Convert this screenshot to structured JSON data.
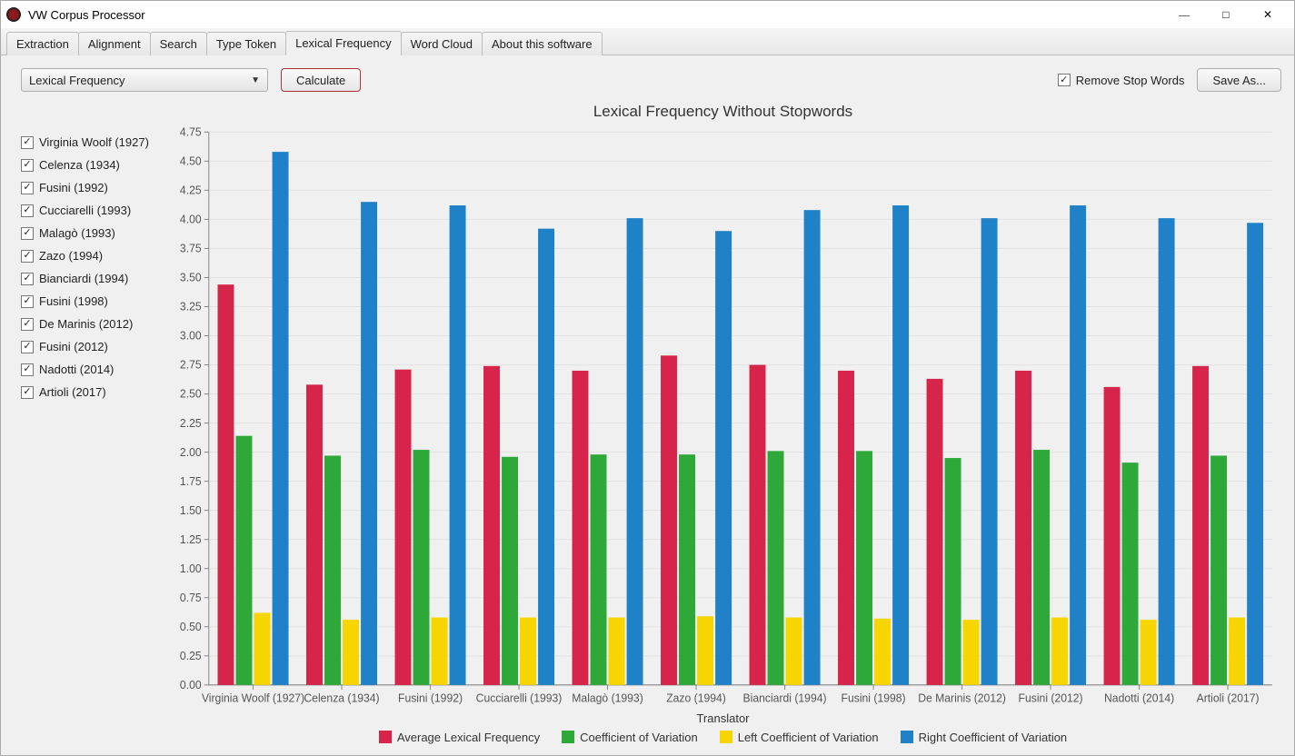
{
  "window": {
    "title": "VW Corpus Processor"
  },
  "tabs": {
    "items": [
      "Extraction",
      "Alignment",
      "Search",
      "Type Token",
      "Lexical Frequency",
      "Word Cloud",
      "About this software"
    ],
    "active_index": 4
  },
  "toolbar": {
    "combo_value": "Lexical Frequency",
    "calculate_label": "Calculate",
    "remove_stopwords_label": "Remove Stop Words",
    "remove_stopwords_checked": true,
    "save_as_label": "Save As..."
  },
  "sidebar": {
    "items": [
      {
        "label": "Virginia Woolf (1927)",
        "checked": true
      },
      {
        "label": "Celenza (1934)",
        "checked": true
      },
      {
        "label": "Fusini (1992)",
        "checked": true
      },
      {
        "label": "Cucciarelli (1993)",
        "checked": true
      },
      {
        "label": "Malagò (1993)",
        "checked": true
      },
      {
        "label": "Zazo (1994)",
        "checked": true
      },
      {
        "label": "Bianciardi (1994)",
        "checked": true
      },
      {
        "label": "Fusini (1998)",
        "checked": true
      },
      {
        "label": "De Marinis (2012)",
        "checked": true
      },
      {
        "label": "Fusini (2012)",
        "checked": true
      },
      {
        "label": "Nadotti (2014)",
        "checked": true
      },
      {
        "label": "Artioli (2017)",
        "checked": true
      }
    ]
  },
  "chart": {
    "title": "Lexical Frequency Without Stopwords",
    "xlabel": "Translator",
    "legend": [
      "Average Lexical Frequency",
      "Coefficient of Variation",
      "Left Coefficient of Variation",
      "Right Coefficient of Variation"
    ],
    "colors": {
      "avg": "#d7244a",
      "cv": "#2fa83a",
      "lcv": "#f7d500",
      "rcv": "#1f82c8"
    },
    "y_ticks": [
      0.0,
      0.25,
      0.5,
      0.75,
      1.0,
      1.25,
      1.5,
      1.75,
      2.0,
      2.25,
      2.5,
      2.75,
      3.0,
      3.25,
      3.5,
      3.75,
      4.0,
      4.25,
      4.5,
      4.75
    ]
  },
  "chart_data": {
    "type": "bar",
    "categories": [
      "Virginia Woolf (1927)",
      "Celenza (1934)",
      "Fusini (1992)",
      "Cucciarelli (1993)",
      "Malagò (1993)",
      "Zazo (1994)",
      "Bianciardi (1994)",
      "Fusini (1998)",
      "De Marinis (2012)",
      "Fusini (2012)",
      "Nadotti (2014)",
      "Artioli (2017)"
    ],
    "series": [
      {
        "name": "Average Lexical Frequency",
        "values": [
          3.44,
          2.58,
          2.71,
          2.74,
          2.7,
          2.83,
          2.75,
          2.7,
          2.63,
          2.7,
          2.56,
          2.74
        ]
      },
      {
        "name": "Coefficient of Variation",
        "values": [
          2.14,
          1.97,
          2.02,
          1.96,
          1.98,
          1.98,
          2.01,
          2.01,
          1.95,
          2.02,
          1.91,
          1.97
        ]
      },
      {
        "name": "Left Coefficient of Variation",
        "values": [
          0.62,
          0.56,
          0.58,
          0.58,
          0.58,
          0.59,
          0.58,
          0.57,
          0.56,
          0.58,
          0.56,
          0.58
        ]
      },
      {
        "name": "Right Coefficient of Variation",
        "values": [
          4.58,
          4.15,
          4.12,
          3.92,
          4.01,
          3.9,
          4.08,
          4.12,
          4.01,
          4.12,
          4.01,
          3.97
        ]
      }
    ],
    "title": "Lexical Frequency Without Stopwords",
    "xlabel": "Translator",
    "ylabel": "",
    "ylim": [
      0,
      4.75
    ]
  }
}
